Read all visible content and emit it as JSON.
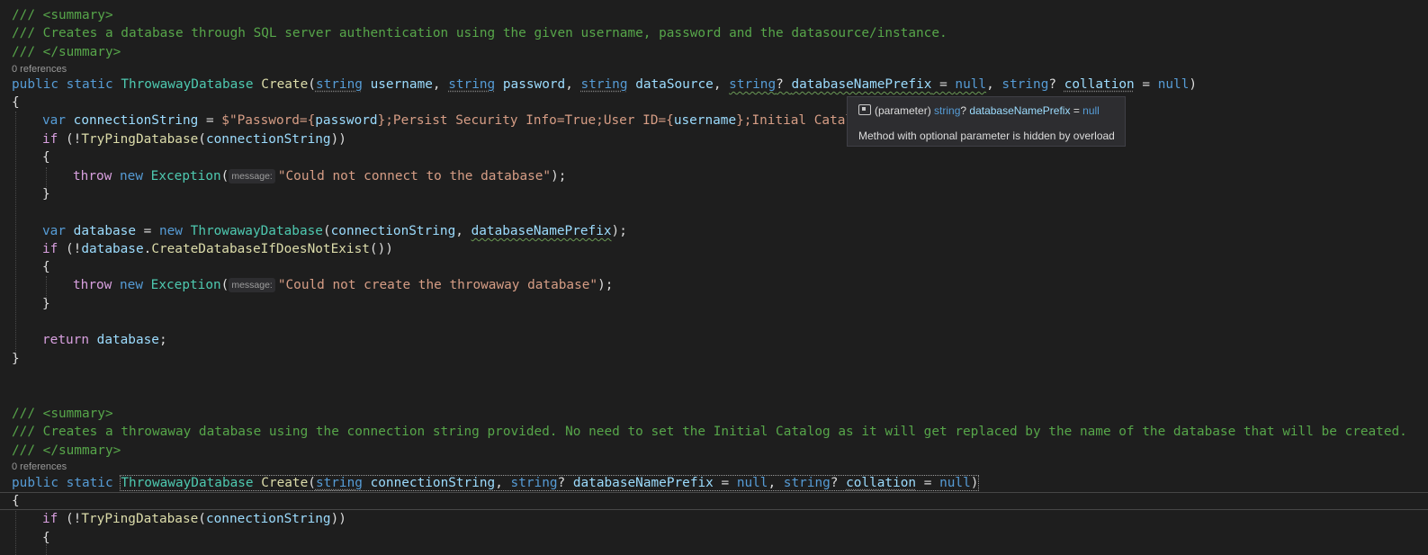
{
  "tooltip": {
    "icon": "parameter-icon",
    "kind": "(parameter)",
    "type": "string",
    "nullable": "?",
    "name": "databaseNamePrefix",
    "eq": "=",
    "default": "null",
    "message": "Method with optional parameter is hidden by overload"
  },
  "code": {
    "l1": "/// <summary>",
    "l2": "/// Creates a database through SQL server authentication using the given username, password and the datasource/instance.",
    "l3": "/// </summary>",
    "refs1": "0 references",
    "sig1": {
      "public": "public",
      "static": "static",
      "ret": "ThrowawayDatabase",
      "name": "Create",
      "string": "string",
      "p_user": "username",
      "p_pass": "password",
      "p_ds": "dataSource",
      "p_prefix": "databaseNamePrefix",
      "null": "null",
      "p_coll": "collation"
    },
    "var": "var",
    "connstr": "connectionString",
    "connstr_value_a": "$\"Password={",
    "connstr_value_b": "password",
    "connstr_value_c": "};Persist Security Info=True;User ID={",
    "connstr_value_d": "username",
    "connstr_value_e": "};Initial Catalo",
    "if": "if",
    "trypng": "TryPingDatabase",
    "throw": "throw",
    "new": "new",
    "exception": "Exception",
    "hint_message": "message:",
    "err1": "\"Could not connect to the database\"",
    "database": "database",
    "ctor_type": "ThrowawayDatabase",
    "create_if": "CreateDatabaseIfDoesNotExist",
    "err2": "\"Could not create the throwaway database\"",
    "return": "return",
    "l20": "/// <summary>",
    "l21": "/// Creates a throwaway database using the connection string provided. No need to set the Initial Catalog as it will get replaced by the name of the database that will be created.",
    "l22": "/// </summary>",
    "refs2": "0 references"
  }
}
